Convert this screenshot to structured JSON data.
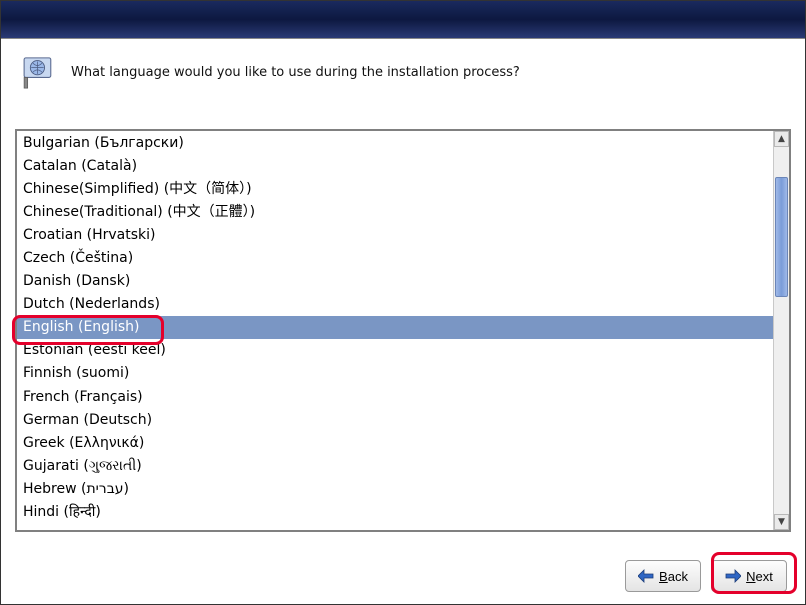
{
  "prompt": "What language would you like to use during the installation process?",
  "languages": [
    "Bulgarian (Български)",
    "Catalan (Català)",
    "Chinese(Simplified) (中文（简体）)",
    "Chinese(Traditional) (中文（正體）)",
    "Croatian (Hrvatski)",
    "Czech (Čeština)",
    "Danish (Dansk)",
    "Dutch (Nederlands)",
    "English (English)",
    "Estonian (eesti keel)",
    "Finnish (suomi)",
    "French (Français)",
    "German (Deutsch)",
    "Greek (Ελληνικά)",
    "Gujarati (ગુજરાતી)",
    "Hebrew (עברית)",
    "Hindi (हिन्दी)"
  ],
  "selected_index": 8,
  "buttons": {
    "back": "Back",
    "next": "Next"
  }
}
